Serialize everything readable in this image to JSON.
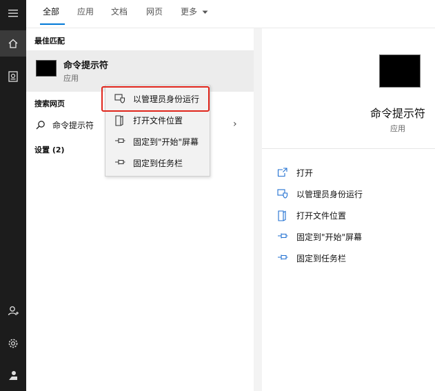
{
  "tabs": [
    "全部",
    "应用",
    "文档",
    "网页",
    "更多"
  ],
  "results": {
    "best_match_heading": "最佳匹配",
    "best_match": {
      "title": "命令提示符",
      "subtitle": "应用"
    },
    "web_heading": "搜索网页",
    "web_query": "命令提示符",
    "settings_heading": "设置 (2)"
  },
  "context_menu": [
    {
      "label": "以管理员身份运行",
      "icon": "shield-run-icon"
    },
    {
      "label": "打开文件位置",
      "icon": "folder-location-icon"
    },
    {
      "label": "固定到\"开始\"屏幕",
      "icon": "pin-icon"
    },
    {
      "label": "固定到任务栏",
      "icon": "pin-icon"
    }
  ],
  "preview": {
    "title": "命令提示符",
    "subtitle": "应用",
    "actions": [
      {
        "label": "打开",
        "icon": "open-icon"
      },
      {
        "label": "以管理员身份运行",
        "icon": "shield-run-icon"
      },
      {
        "label": "打开文件位置",
        "icon": "folder-location-icon"
      },
      {
        "label": "固定到\"开始\"屏幕",
        "icon": "pin-icon"
      },
      {
        "label": "固定到任务栏",
        "icon": "pin-icon"
      }
    ]
  },
  "colors": {
    "accent": "#0078d7",
    "highlight_border": "#e0251b",
    "rail": "#1c1c1c"
  }
}
